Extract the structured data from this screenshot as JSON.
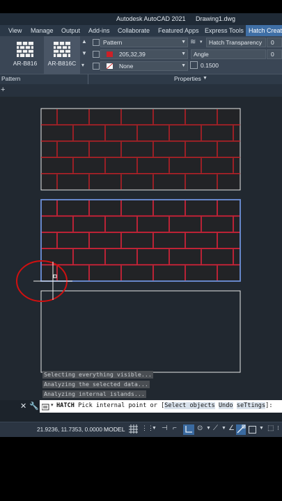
{
  "window": {
    "app_title": "Autodesk AutoCAD 2021",
    "drawing_title": "Drawing1.dwg"
  },
  "tabs": [
    "View",
    "Manage",
    "Output",
    "Add-ins",
    "Collaborate",
    "Featured Apps",
    "Express Tools",
    "Hatch Creation"
  ],
  "ribbon": {
    "patterns": [
      {
        "label": "AR-B816",
        "icon": "brick-pattern-icon"
      },
      {
        "label": "AR-B816C",
        "icon": "brick-pattern-icon"
      }
    ],
    "pattern_type": "Pattern",
    "hatch_color": "205,32,39",
    "hatch_color_swatch": "#cd2027",
    "background_color": "None",
    "transparency_label": "Hatch Transparency",
    "transparency_value": "0",
    "angle_label": "Angle",
    "angle_value": "0",
    "scale_value": "0.1500",
    "panels": {
      "pattern": "Pattern",
      "properties": "Properties"
    }
  },
  "command_log": [
    "Selecting everything visible...",
    "Analyzing the selected data...",
    "Analyzing internal islands..."
  ],
  "command_line": {
    "command": "HATCH",
    "prompt": "Pick internal point or [",
    "options": [
      "Select objects",
      "Undo",
      "seTtings"
    ],
    "end": "]:"
  },
  "status_bar": {
    "coordinates": "21.9236, 11.7353, 0.0000",
    "space": "MODEL"
  },
  "colors": {
    "hatch_red": "#cd2027",
    "selection_blue": "#6d8fd8",
    "active_tab": "#3f6fa6",
    "canvas": "#212830"
  }
}
